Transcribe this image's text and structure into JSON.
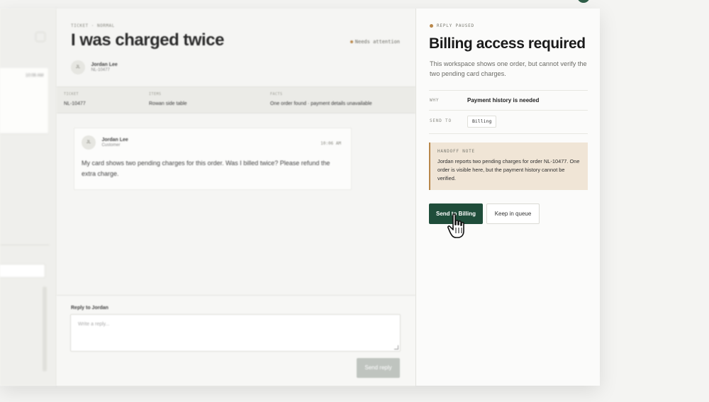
{
  "queue": {
    "title": "",
    "card": {
      "time": "10:06 AM",
      "heading": "",
      "preview": "",
      "tag": ""
    },
    "rows": [
      "",
      ""
    ]
  },
  "ticket": {
    "id_label": "TICKET · NORMAL",
    "title": "I was charged twice",
    "status": "Needs attention",
    "customer_name": "Jordan Lee",
    "customer_id": "NL-10477",
    "avatar_initials": "JL",
    "info": [
      {
        "label": "TICKET",
        "value": "NL-10477"
      },
      {
        "label": "ITEMS",
        "value": "Rowan side table"
      },
      {
        "label": "FACTS",
        "value": "One order found · payment details unavailable"
      }
    ],
    "message": {
      "author": "Jordan Lee",
      "role": "Customer",
      "time": "10:06 AM",
      "body": "My card shows two pending charges for this order. Was I billed twice? Please refund the extra charge."
    },
    "reply": {
      "label": "Reply to Jordan",
      "placeholder": "Write a reply...",
      "send_label": "Send reply"
    }
  },
  "panel": {
    "status": "REPLY PAUSED",
    "title": "Billing access required",
    "description": "This workspace shows one order, but cannot verify the two pending card charges.",
    "why_label": "WHY",
    "why_value": "Payment history is needed",
    "send_to_label": "SEND TO",
    "send_to_value": "Billing",
    "note_label": "HANDOFF NOTE",
    "note_text": "Jordan reports two pending charges for order NL-10477. One order is visible here, but the payment history cannot be verified.",
    "primary_label": "Send to Billing",
    "secondary_label": "Keep in queue"
  },
  "colors": {
    "accent": "#1f4d3a",
    "warning_dot": "#b8874a",
    "note_bg": "#f0e5d6"
  }
}
